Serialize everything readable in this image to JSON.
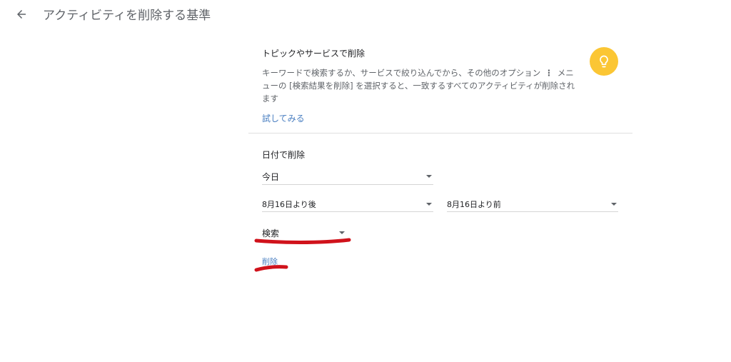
{
  "header": {
    "title": "アクティビティを削除する基準",
    "back_icon": "arrow-back-icon"
  },
  "topic_section": {
    "title": "トピックやサービスで削除",
    "description_part1": "キーワードで検索するか、サービスで絞り込んでから、その他のオプション",
    "description_part2": "メニューの [検索結果を削除] を選択すると、一致するすべてのアクティビティが削除されます",
    "more_icon": "more-vert-icon",
    "try_link": "試してみる",
    "tip_icon": "lightbulb-icon",
    "tip_icon_color": "#fbc634"
  },
  "date_section": {
    "title": "日付で削除",
    "range_select": "今日",
    "after_select": "8月16日より後",
    "before_select": "8月16日より前",
    "product_select": "検索",
    "delete_link": "削除"
  },
  "colors": {
    "link": "#4a7fc1",
    "annotation": "#d0121b"
  }
}
